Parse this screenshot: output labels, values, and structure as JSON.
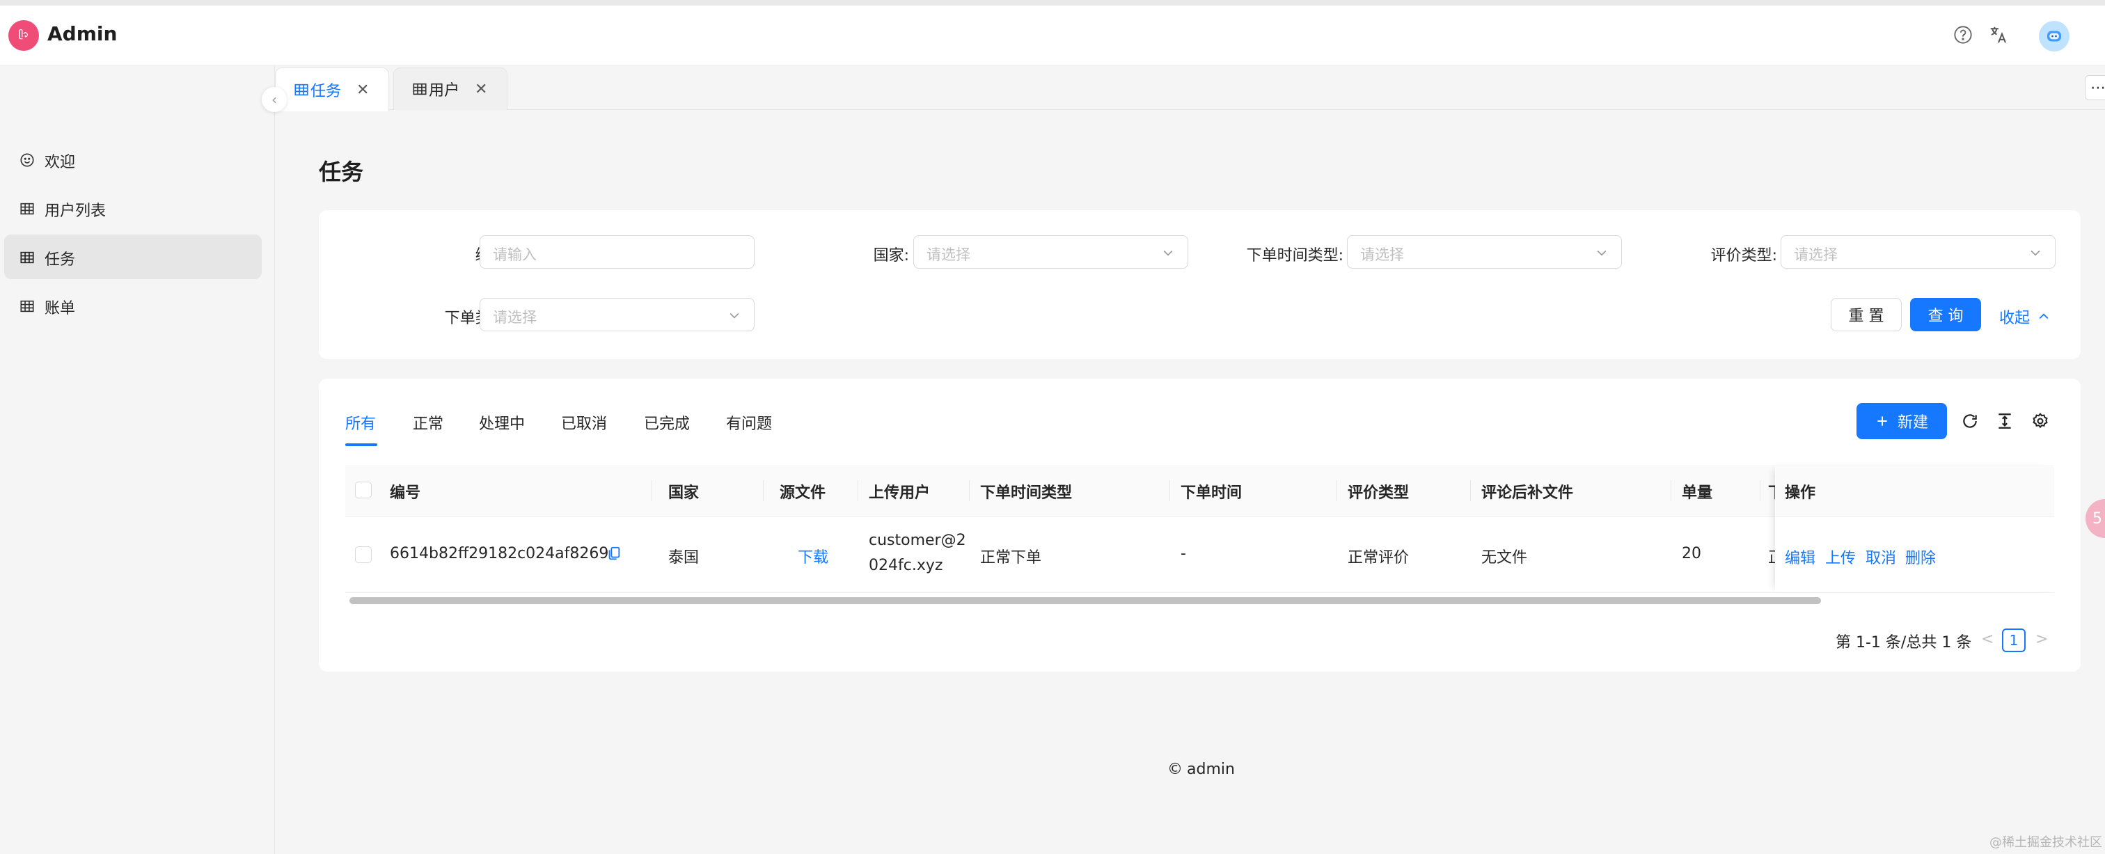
{
  "app": {
    "brand": "Admin",
    "logo_text": "ᥫ᭡"
  },
  "header": {
    "help_icon": "question-circle-icon",
    "translate_icon": "translate-icon",
    "avatar_icon": "robot-avatar-icon"
  },
  "sidebar": {
    "items": [
      {
        "label": "欢迎",
        "icon": "smile-icon"
      },
      {
        "label": "用户列表",
        "icon": "table-icon"
      },
      {
        "label": "任务",
        "icon": "table-icon",
        "active": true
      },
      {
        "label": "账单",
        "icon": "table-icon"
      }
    ]
  },
  "page_tabs": [
    {
      "label": "任务",
      "active": true
    },
    {
      "label": "用户",
      "active": false
    }
  ],
  "page": {
    "title": "任务"
  },
  "search": {
    "fields": [
      {
        "label": "编号:",
        "placeholder": "请输入",
        "type": "input"
      },
      {
        "label": "国家:",
        "placeholder": "请选择",
        "type": "select"
      },
      {
        "label": "下单时间类型:",
        "placeholder": "请选择",
        "type": "select"
      },
      {
        "label": "评价类型:",
        "placeholder": "请选择",
        "type": "select"
      },
      {
        "label": "下单类型:",
        "placeholder": "请选择",
        "type": "select"
      }
    ],
    "reset_label": "重 置",
    "query_label": "查 询",
    "collapse_label": "收起"
  },
  "status_tabs": [
    "所有",
    "正常",
    "处理中",
    "已取消",
    "已完成",
    "有问题"
  ],
  "toolbar": {
    "new_label": "新建",
    "new_icon": "plus-icon"
  },
  "table": {
    "columns": [
      "编号",
      "国家",
      "源文件",
      "上传用户",
      "下单时间类型",
      "下单时间",
      "评价类型",
      "评论后补文件",
      "单量",
      "下",
      "操作"
    ],
    "rows": [
      {
        "id": "6614b82ff29182c024af8269",
        "country": "泰国",
        "source_file": "下载",
        "upload_user_line1": "customer@2",
        "upload_user_line2": "024fc.xyz",
        "order_time_type": "正常下单",
        "order_time": "-",
        "review_type": "正常评价",
        "review_file": "无文件",
        "quantity": "20",
        "partial_col": "正",
        "actions": [
          "编辑",
          "上传",
          "取消",
          "删除"
        ]
      }
    ]
  },
  "pagination": {
    "total_text": "第 1-1 条/总共 1 条",
    "current_page": "1",
    "prev": "<",
    "next": ">"
  },
  "footer": {
    "copyright_symbol": "©",
    "text": "admin"
  },
  "watermark": "@稀土掘金技术社区",
  "colors": {
    "primary": "#1677ff",
    "logo": "#ef4d78"
  }
}
